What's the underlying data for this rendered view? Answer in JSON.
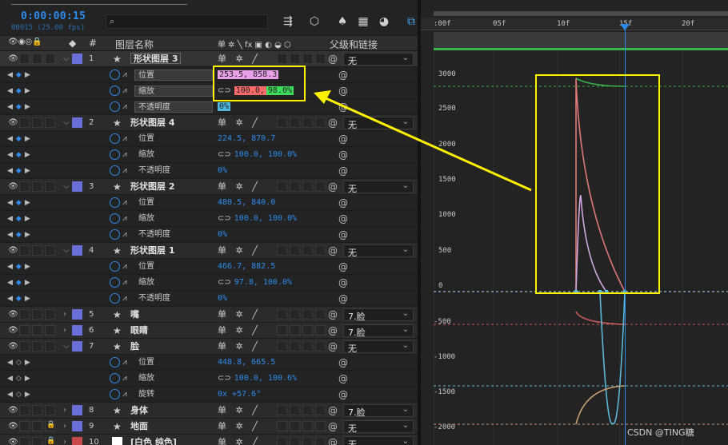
{
  "timecode": "0:00:00:15",
  "frames": "00015 (25.00 fps)",
  "search": {
    "icon": "⌕",
    "placeholder": ""
  },
  "header": {
    "name": "图层名称",
    "num": "#",
    "switches": "单 ✲ ╲ fx ▣ ◐ ◒ ⬡",
    "parent": "父级和链接"
  },
  "chain_icon": "⊂⊃",
  "switch_icons": "单 ✲ ╱",
  "rows": [
    {
      "type": "layer",
      "num": "1",
      "name": "形状图层 3",
      "label": "#6b6fd9",
      "open": true,
      "parent": "无",
      "selected": true,
      "boxed": true
    },
    {
      "type": "prop",
      "name": "位置",
      "val": "253.5, 858.3",
      "hl": "#e8a0e8",
      "boxed": true
    },
    {
      "type": "prop",
      "name": "缩放",
      "val": "100.0, 98.0%",
      "hl": "#3ddc5a",
      "hl2": "#ff6a6a",
      "chain": true,
      "boxed": true
    },
    {
      "type": "prop",
      "name": "不透明度",
      "val": "0%",
      "hl": "#4fb7e0",
      "boxed": true
    },
    {
      "type": "layer",
      "num": "2",
      "name": "形状图层 4",
      "label": "#6b6fd9",
      "open": true,
      "parent": "无"
    },
    {
      "type": "prop",
      "name": "位置",
      "val": "224.5, 870.7"
    },
    {
      "type": "prop",
      "name": "缩放",
      "val": "100.0, 100.0%",
      "chain": true
    },
    {
      "type": "prop",
      "name": "不透明度",
      "val": "0%"
    },
    {
      "type": "layer",
      "num": "3",
      "name": "形状图层 2",
      "label": "#6b6fd9",
      "open": true,
      "parent": "无"
    },
    {
      "type": "prop",
      "name": "位置",
      "val": "480.5, 840.0"
    },
    {
      "type": "prop",
      "name": "缩放",
      "val": "100.0, 100.0%",
      "chain": true
    },
    {
      "type": "prop",
      "name": "不透明度",
      "val": "0%"
    },
    {
      "type": "layer",
      "num": "4",
      "name": "形状图层 1",
      "label": "#6b6fd9",
      "open": true,
      "parent": "无"
    },
    {
      "type": "prop",
      "name": "位置",
      "val": "466.7, 882.5"
    },
    {
      "type": "prop",
      "name": "缩放",
      "val": "97.8, 100.0%",
      "chain": true
    },
    {
      "type": "prop",
      "name": "不透明度",
      "val": "0%"
    },
    {
      "type": "layer",
      "num": "5",
      "name": "嘴",
      "label": "#6b6fd9",
      "open": false,
      "parent": "7.脸"
    },
    {
      "type": "layer",
      "num": "6",
      "name": "眼睛",
      "label": "#6b6fd9",
      "open": false,
      "parent": "7.脸"
    },
    {
      "type": "layer",
      "num": "7",
      "name": "脸",
      "label": "#6b6fd9",
      "open": true,
      "parent": "无"
    },
    {
      "type": "prop",
      "name": "位置",
      "val": "448.8, 665.5",
      "nokey": true
    },
    {
      "type": "prop",
      "name": "缩放",
      "val": "100.0, 100.6%",
      "chain": true,
      "nokey": true
    },
    {
      "type": "prop",
      "name": "旋转",
      "val": "0x +57.6°",
      "nokey": true
    },
    {
      "type": "layer",
      "num": "8",
      "name": "身体",
      "label": "#6b6fd9",
      "open": false,
      "parent": "7.脸"
    },
    {
      "type": "layer",
      "num": "9",
      "name": "地面",
      "label": "#6b6fd9",
      "open": false,
      "parent": "无",
      "locked": true
    },
    {
      "type": "layer",
      "num": "10",
      "name": "[白色 纯色]",
      "label": "#c94a4a",
      "open": false,
      "parent": "无",
      "locked": true,
      "white": true
    }
  ],
  "ruler": [
    ":00f",
    "05f",
    "10f",
    "15f",
    "20f"
  ],
  "yaxis": [
    "3000",
    "2500",
    "2000",
    "1500",
    "1000",
    "500",
    "0",
    "-500",
    "-1000",
    "-1500",
    "-2000"
  ],
  "watermark": "CSDN @TING糖"
}
